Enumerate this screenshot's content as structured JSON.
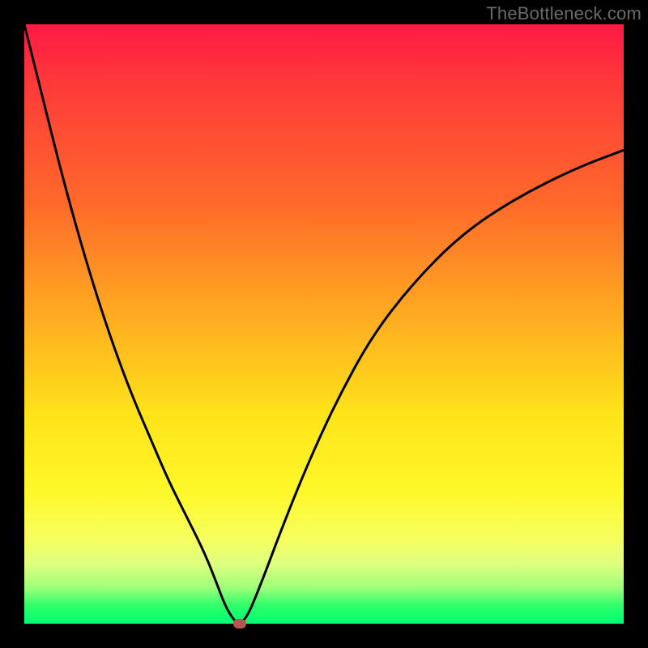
{
  "watermark": "TheBottleneck.com",
  "colors": {
    "curve_stroke": "#000000",
    "marker_fill": "#b8564e",
    "background": "#000000"
  },
  "chart_data": {
    "type": "line",
    "title": "",
    "xlabel": "",
    "ylabel": "",
    "xlim": [
      0,
      100
    ],
    "ylim": [
      0,
      100
    ],
    "grid": false,
    "legend": null,
    "series": [
      {
        "name": "curve",
        "x": [
          0,
          3,
          6,
          9,
          12,
          15,
          18,
          21,
          24,
          27,
          30,
          32,
          33.5,
          35,
          36,
          37,
          38,
          40,
          43,
          47,
          52,
          58,
          65,
          73,
          82,
          92,
          100
        ],
        "y": [
          100,
          88,
          76,
          65,
          55,
          46,
          38,
          31,
          24,
          18,
          12,
          7,
          3,
          0.5,
          0,
          1,
          3,
          8,
          16,
          26,
          37,
          48,
          57,
          65,
          71,
          76,
          79
        ]
      }
    ],
    "marker": {
      "x": 36,
      "y": 0
    },
    "annotations": []
  }
}
